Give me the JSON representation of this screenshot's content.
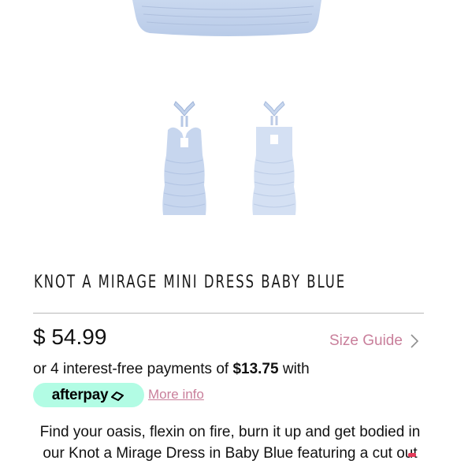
{
  "product": {
    "title": "KNOT A MIRAGE MINI DRESS BABY BLUE",
    "price": "$ 54.99",
    "size_guide_label": "Size Guide",
    "installments": {
      "prefix": "or 4 interest-free payments of ",
      "amount": "$13.75",
      "suffix": " with"
    },
    "afterpay": {
      "brand": "afterpay",
      "more_info_label": "More info"
    },
    "description": "Find your oasis, flexin on fire, burn it up and get bodied in our Knot a Mirage Dress in Baby Blue featuring a cut out"
  },
  "colors": {
    "accent_pink": "#c97f9b",
    "afterpay_mint": "#b2fce4",
    "dress_blue": "#c7d6ee"
  },
  "icons": {
    "size_guide": "chevron-right-icon",
    "afterpay": "afterpay-arrows-icon"
  }
}
